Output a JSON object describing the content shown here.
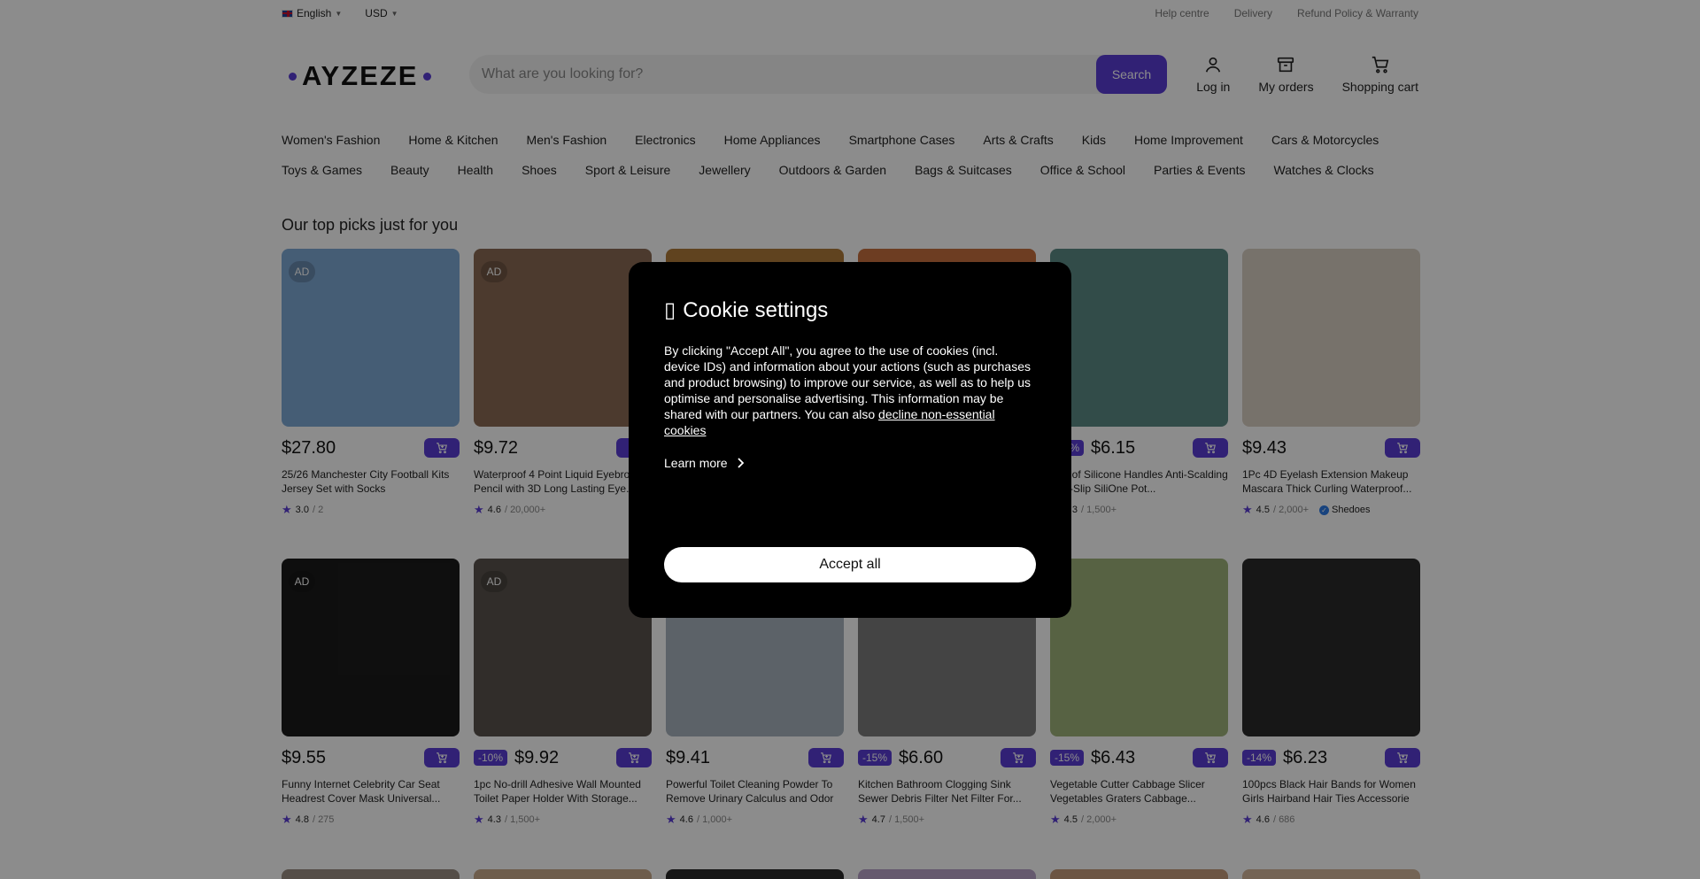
{
  "topbar": {
    "language": "English",
    "currency": "USD",
    "links": [
      "Help centre",
      "Delivery",
      "Refund Policy & Warranty"
    ]
  },
  "header": {
    "logo": "AYZEZE",
    "search_placeholder": "What are you looking for?",
    "search_button": "Search",
    "actions": [
      {
        "label": "Log in",
        "icon": "user-icon"
      },
      {
        "label": "My orders",
        "icon": "orders-box-icon"
      },
      {
        "label": "Shopping cart",
        "icon": "cart-icon"
      }
    ]
  },
  "categories": {
    "row1": [
      "Women's Fashion",
      "Home & Kitchen",
      "Men's Fashion",
      "Electronics",
      "Home Appliances",
      "Smartphone Cases",
      "Arts & Crafts",
      "Kids",
      "Home Improvement",
      "Cars & Motorcycles"
    ],
    "row2": [
      "Toys & Games",
      "Beauty",
      "Health",
      "Shoes",
      "Sport & Leisure",
      "Jewellery",
      "Outdoors & Garden",
      "Bags & Suitcases",
      "Office & School",
      "Parties & Events",
      "Watches & Clocks"
    ]
  },
  "section_title": "Our top picks just for you",
  "products": [
    {
      "ad": "AD",
      "discount": "",
      "price": "$27.80",
      "title": "25/26 Manchester City Football Kits Jersey Set with Socks",
      "rating": "3.0",
      "count": "/ 2",
      "seller": "",
      "color": "#7fa9d6"
    },
    {
      "ad": "AD",
      "discount": "",
      "price": "$9.72",
      "title": "Waterproof 4 Point Liquid Eyebrow Pencil with 3D Long Lasting Eye...",
      "rating": "4.6",
      "count": "/ 20,000+",
      "seller": "",
      "color": "#8a6b54"
    },
    {
      "ad": "",
      "discount": "",
      "price": "",
      "title": "",
      "rating": "",
      "count": "",
      "seller": "",
      "color": "#b07a3a"
    },
    {
      "ad": "",
      "discount": "",
      "price": "",
      "title": "",
      "rating": "",
      "count": "",
      "seller": "",
      "color": "#c7703f"
    },
    {
      "ad": "",
      "discount": "-15%",
      "price": "$6.15",
      "title": "Pair of Silicone Handles Anti-Scalding Non-Slip SiliOne Pot...",
      "rating": "4.3",
      "count": "/ 1,500+",
      "seller": "",
      "color": "#5c8a86"
    },
    {
      "ad": "",
      "discount": "",
      "price": "$9.43",
      "title": "1Pc 4D Eyelash Extension Makeup Mascara Thick Curling Waterproof...",
      "rating": "4.5",
      "count": "/ 2,000+",
      "seller": "Shedoes",
      "color": "#d9cfc4"
    },
    {
      "ad": "AD",
      "discount": "",
      "price": "$9.55",
      "title": "Funny Internet Celebrity Car Seat Headrest Cover Mask Universal...",
      "rating": "4.8",
      "count": "/ 275",
      "seller": "",
      "color": "#1b1b1b"
    },
    {
      "ad": "AD",
      "discount": "-10%",
      "price": "$9.92",
      "title": "1pc No-drill Adhesive Wall Mounted Toilet Paper Holder With Storage...",
      "rating": "4.3",
      "count": "/ 1,500+",
      "seller": "",
      "color": "#5a534d"
    },
    {
      "ad": "",
      "discount": "",
      "price": "$9.41",
      "title": "Powerful Toilet Cleaning Powder To Remove Urinary Calculus and Odor",
      "rating": "4.6",
      "count": "/ 1,000+",
      "seller": "",
      "color": "#a8b3bd"
    },
    {
      "ad": "",
      "discount": "-15%",
      "price": "$6.60",
      "title": "Kitchen Bathroom Clogging Sink Sewer Debris Filter Net Filter For...",
      "rating": "4.7",
      "count": "/ 1,500+",
      "seller": "",
      "color": "#7d7d7d"
    },
    {
      "ad": "",
      "discount": "-15%",
      "price": "$6.43",
      "title": "Vegetable Cutter Cabbage Slicer Vegetables Graters Cabbage...",
      "rating": "4.5",
      "count": "/ 2,000+",
      "seller": "",
      "color": "#9fb37a"
    },
    {
      "ad": "",
      "discount": "-14%",
      "price": "$6.23",
      "title": "100pcs Black Hair Bands for Women Girls Hairband Hair Ties Accessorie",
      "rating": "4.6",
      "count": "/ 686",
      "seller": "",
      "color": "#2a2a2a"
    }
  ],
  "row3_colors": [
    "#9b8f84",
    "#c9a98a",
    "#2b2b2b",
    "#b9a3c8",
    "#c59b7a",
    "#d3b79c"
  ],
  "cookie": {
    "title": "Cookie settings",
    "text_before": "By clicking \"Accept All\", you agree to the use of cookies (incl. device IDs) and information about your actions (such as purchases and product browsing) to improve our service, as well as to help us optimise and personalise advertising. This information may be shared with our partners. You can also ",
    "decline_link": "decline non-essential cookies",
    "learn_more": "Learn more",
    "accept_all": "Accept all"
  },
  "colors": {
    "accent": "#5a3cd6",
    "overlay": "rgba(0,0,0,0.45)"
  }
}
